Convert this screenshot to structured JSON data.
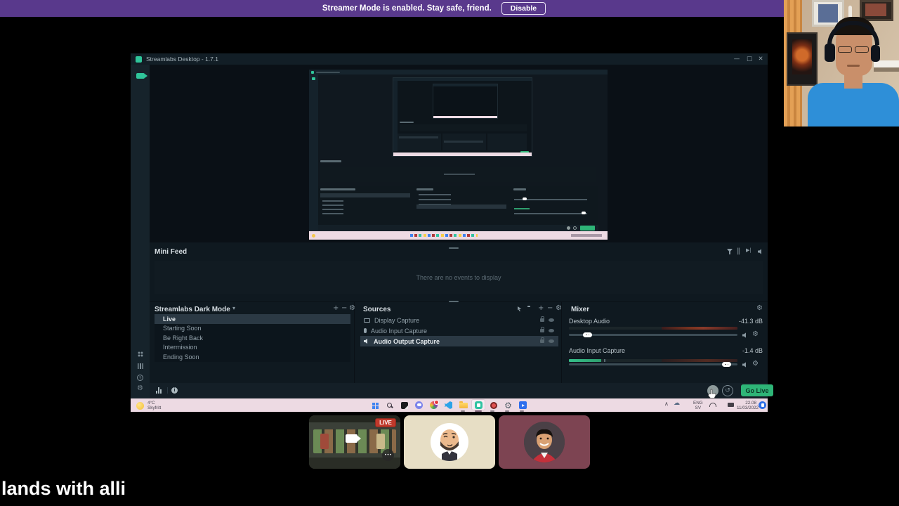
{
  "banner": {
    "text": "Streamer Mode is enabled. Stay safe, friend.",
    "disable_label": "Disable"
  },
  "window": {
    "title": "Streamlabs Desktop - 1.7.1"
  },
  "icons": {
    "minimize": "—",
    "maximize": "□",
    "close": "✕",
    "gear": "⚙",
    "plus": "+",
    "minus": "−",
    "chevron_down": "▾",
    "replay": "↺",
    "pause": "‖",
    "skip": "▶|",
    "info": "i",
    "help": "?",
    "up_chevron": "∧",
    "cloud": "☁",
    "ellipsis": "•••"
  },
  "mini_feed": {
    "title": "Mini Feed",
    "empty_text": "There are no events to display"
  },
  "scenes": {
    "title": "Streamlabs Dark Mode",
    "items": [
      {
        "label": "Live"
      },
      {
        "label": "Starting Soon"
      },
      {
        "label": "Be Right Back"
      },
      {
        "label": "Intermission"
      },
      {
        "label": "Ending Soon"
      }
    ],
    "selected": "Live"
  },
  "sources": {
    "title": "Sources",
    "items": [
      {
        "label": "Display Capture"
      },
      {
        "label": "Audio Input Capture"
      },
      {
        "label": "Audio Output Capture"
      }
    ],
    "selected": "Audio Output Capture"
  },
  "mixer": {
    "title": "Mixer",
    "channels": [
      {
        "name": "Desktop Audio",
        "level": "-41.3 dB"
      },
      {
        "name": "Audio Input Capture",
        "level": "-1.4 dB"
      }
    ]
  },
  "footer": {
    "go_live": "Go Live"
  },
  "taskbar": {
    "weather": {
      "temp": "4°C",
      "condition": "Skyfritt"
    },
    "language": {
      "line1": "ENG",
      "line2": "SV"
    },
    "clock": {
      "time": "22.08",
      "date": "11/03/2022"
    }
  },
  "stage": {
    "live_badge": "LIVE",
    "ticker": "lands with alli"
  },
  "colors": {
    "accent_green": "#2fc59a",
    "go_live_green": "#2eb577",
    "banner_purple": "#59398c",
    "taskbar_pink": "#eddae3",
    "live_red": "#c0392b",
    "selection": "#2b3944"
  }
}
